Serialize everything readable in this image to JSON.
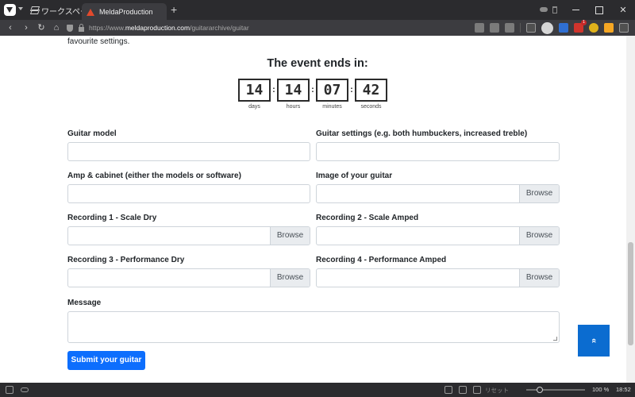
{
  "browser": {
    "workspace_label": "ワークスペース",
    "tab_title": "MeldaProduction",
    "new_tab": "+",
    "url_prefix": "https://www.",
    "url_host": "meldaproduction.com",
    "url_path": "/guitararchive/guitar",
    "extension_badge": "1",
    "window_controls": {
      "minimize": "",
      "maximize": "",
      "close": "✕"
    },
    "nav": {
      "back": "‹",
      "forward": "›",
      "reload": "↻",
      "home": "⌂"
    },
    "icons": [
      "translate-icon",
      "reader-icon",
      "bookmark-icon",
      "panel-icon",
      "avatar",
      "translate-ext-icon",
      "mail-ext-icon",
      "wallet-ext-icon",
      "star-ext-icon",
      "extensions-icon"
    ]
  },
  "page": {
    "intro_text": "favourite settings.",
    "countdown": {
      "title": "The event ends in:",
      "units": [
        {
          "value": "14",
          "label": "days"
        },
        {
          "value": "14",
          "label": "hours"
        },
        {
          "value": "07",
          "label": "minutes"
        },
        {
          "value": "42",
          "label": "seconds"
        }
      ],
      "separator": ":"
    },
    "form": {
      "guitar_model_label": "Guitar model",
      "guitar_settings_label": "Guitar settings (e.g. both humbuckers, increased treble)",
      "amp_label": "Amp & cabinet (either the models or software)",
      "image_label": "Image of your guitar",
      "rec1_label": "Recording 1 - Scale Dry",
      "rec2_label": "Recording 2 - Scale Amped",
      "rec3_label": "Recording 3 - Performance Dry",
      "rec4_label": "Recording 4 - Performance Amped",
      "message_label": "Message",
      "browse_label": "Browse",
      "submit_label": "Submit your guitar"
    },
    "scroll_top_label": "«"
  },
  "statusbar": {
    "reset_label": "リセット",
    "zoom": "100 %",
    "time": "18:52",
    "zoom_level": 1.0
  }
}
